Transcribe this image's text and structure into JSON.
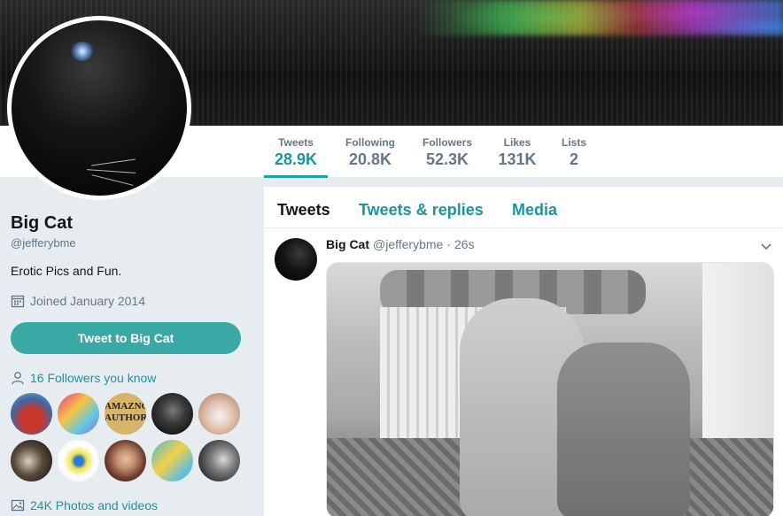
{
  "profile": {
    "name": "Big Cat",
    "handle": "@jefferybme",
    "bio": "Erotic Pics and Fun.",
    "joined": "Joined January 2014",
    "tweet_to_button": "Tweet to Big Cat",
    "followers_you_know": "16 Followers you know",
    "photos_videos": "24K Photos and videos",
    "follower_thumbs": [
      {
        "text": ""
      },
      {
        "text": ""
      },
      {
        "text": "AMAZNG AUTHORS"
      },
      {
        "text": ""
      },
      {
        "text": ""
      },
      {
        "text": ""
      },
      {
        "text": ""
      },
      {
        "text": ""
      },
      {
        "text": ""
      },
      {
        "text": ""
      }
    ]
  },
  "nav": {
    "items": [
      {
        "label": "Tweets",
        "value": "28.9K",
        "active": true
      },
      {
        "label": "Following",
        "value": "20.8K"
      },
      {
        "label": "Followers",
        "value": "52.3K"
      },
      {
        "label": "Likes",
        "value": "131K"
      },
      {
        "label": "Lists",
        "value": "2"
      }
    ]
  },
  "timeline": {
    "tabs": [
      {
        "label": "Tweets",
        "active": true
      },
      {
        "label": "Tweets & replies"
      },
      {
        "label": "Media"
      }
    ],
    "tweet": {
      "name": "Big Cat",
      "handle": "@jefferybme",
      "time": "26s",
      "separator": "·"
    }
  },
  "colors": {
    "accent": "#1b95a0",
    "button": "#3aa8a4",
    "muted": "#657786",
    "background": "#e6ecf0"
  },
  "icons": {
    "calendar": "calendar-icon",
    "person": "person-icon",
    "image": "image-icon",
    "caret": "chevron-down-icon"
  }
}
